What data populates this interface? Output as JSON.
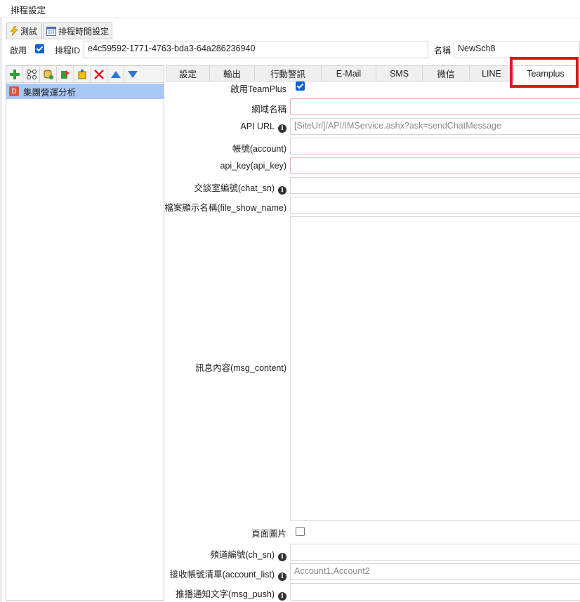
{
  "window": {
    "title": "排程設定"
  },
  "toolbar": {
    "test_label": "測試",
    "schedule_time_label": "排程時間設定"
  },
  "header": {
    "enable_label": "啟用",
    "enable_checked": true,
    "schedule_id_label": "排程ID",
    "schedule_id_value": "e4c59592-1771-4763-bda3-64a286236940",
    "name_label": "名稱",
    "name_value": "NewSch8"
  },
  "left_panel": {
    "toolbar_icons": [
      "add-icon",
      "nodes-icon",
      "database-icon",
      "export-icon",
      "import-icon",
      "delete-icon",
      "move-up-icon",
      "move-down-icon"
    ],
    "items": [
      {
        "badge": "D",
        "label": "集團營運分析"
      }
    ]
  },
  "tabs": [
    {
      "label": "設定",
      "active": false
    },
    {
      "label": "輸出",
      "active": false
    },
    {
      "label": "行動警訊",
      "active": false
    },
    {
      "label": "E-Mail",
      "active": false
    },
    {
      "label": "SMS",
      "active": false
    },
    {
      "label": "微信",
      "active": false
    },
    {
      "label": "LINE",
      "active": false
    },
    {
      "label": "Teamplus",
      "active": true
    }
  ],
  "form": {
    "enable_teamplus_label": "啟用TeamPlus",
    "enable_teamplus_checked": true,
    "domain_label": "網域名稱",
    "domain_value": "",
    "api_url_label": "API URL",
    "api_url_placeholder": "[SiteUrl]/API/IMService.ashx?ask=sendChatMessage",
    "account_label": "帳號(account)",
    "account_value": "",
    "api_key_label": "api_key(api_key)",
    "api_key_value": "",
    "chat_sn_label": "交談室編號(chat_sn)",
    "chat_sn_value": "",
    "file_show_name_label": "檔案顯示名稱(file_show_name)",
    "file_show_name_value": "",
    "msg_content_label": "訊息內容(msg_content)",
    "msg_content_value": "",
    "page_image_label": "頁面圖片",
    "page_image_checked": false,
    "ch_sn_label": "頻道編號(ch_sn)",
    "ch_sn_value": "",
    "account_list_label": "接收帳號清單(account_list)",
    "account_list_placeholder": "Account1,Account2",
    "msg_push_label": "推播通知文字(msg_push)",
    "msg_push_value": ""
  },
  "colors": {
    "highlight": "#e0161c",
    "selected_row": "#a9c8f5",
    "checkbox": "#0a62d0"
  }
}
